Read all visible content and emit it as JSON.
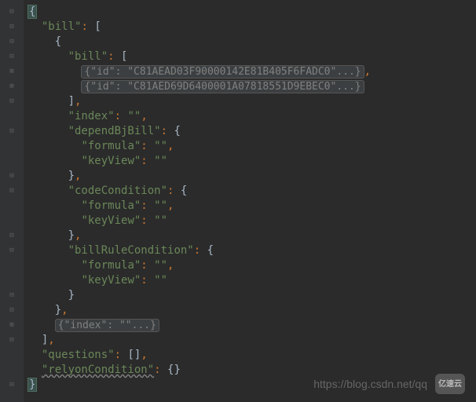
{
  "gutter": {
    "icons": [
      "–",
      "–",
      "–",
      "–",
      "+",
      "+",
      "–",
      "",
      "–",
      "–",
      "",
      "",
      "–",
      "–",
      "–",
      "",
      "",
      "–",
      "–",
      "–",
      "",
      "",
      "–",
      "–",
      "+",
      "–",
      "",
      "",
      ""
    ]
  },
  "code": {
    "l1": "{",
    "l2_key": "\"bill\"",
    "l2_bracket": "[",
    "l3": "{",
    "l4_key": "\"bill\"",
    "l4_bracket": "[",
    "l5_folded": "{\"id\": \"C81AEAD03F90000142E81B405F6FADC0\"...}",
    "l6_folded": "{\"id\": \"C81AED69D6400001A07818551D9EBEC0\"...}",
    "l7": "]",
    "l8_key": "\"index\"",
    "l8_val": "\"\"",
    "l9_key": "\"dependBjBill\"",
    "l9_brace": "{",
    "l10_key": "\"formula\"",
    "l10_val": "\"\"",
    "l11_key": "\"keyView\"",
    "l11_val": "\"\"",
    "l12": "}",
    "l13_key": "\"codeCondition\"",
    "l13_brace": "{",
    "l14_key": "\"formula\"",
    "l14_val": "\"\"",
    "l15_key": "\"keyView\"",
    "l15_val": "\"\"",
    "l16": "}",
    "l17_key": "\"billRuleCondition\"",
    "l17_brace": "{",
    "l18_key": "\"formula\"",
    "l18_val": "\"\"",
    "l19_key": "\"keyView\"",
    "l19_val": "\"\"",
    "l20": "}",
    "l21": "}",
    "l22_folded": "{\"index\": \"\"...}",
    "l23": "]",
    "l24_key": "\"questions\"",
    "l24_val": "[]",
    "l25_key": "\"relyonCondition\"",
    "l25_val": "{}",
    "l26": "}"
  },
  "watermark": {
    "url": "https://blog.csdn.net/qq",
    "logo": "亿速云"
  }
}
